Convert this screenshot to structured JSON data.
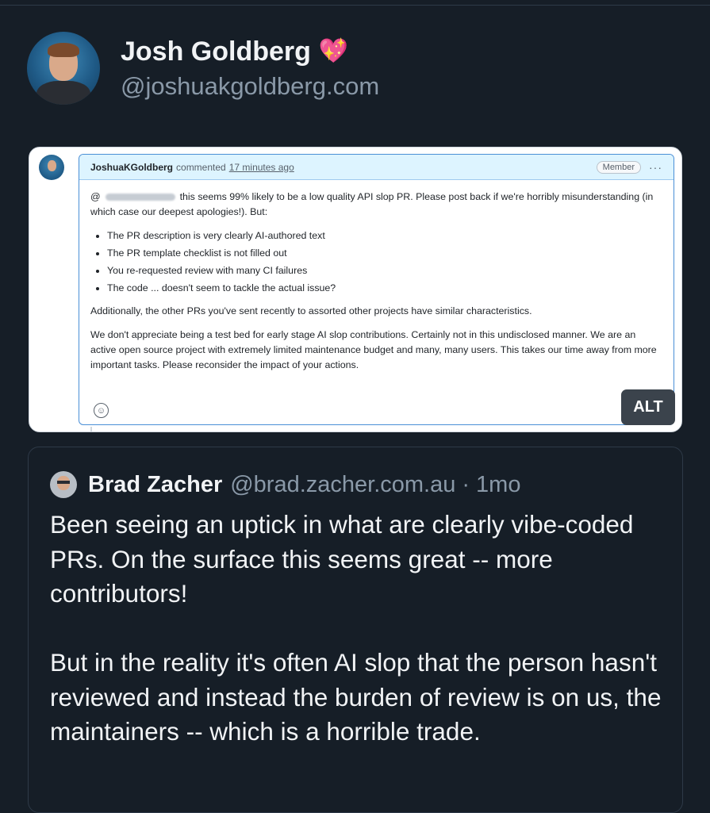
{
  "post": {
    "author_name": "Josh Goldberg",
    "author_emoji": "💖",
    "author_handle": "@joshuakgoldberg.com"
  },
  "embed": {
    "commenter": "JoshuaKGoldberg",
    "commented_label": "commented",
    "time": "17 minutes ago",
    "badge": "Member",
    "menu_glyph": "···",
    "mention_prefix": "@",
    "p1_rest": "this seems 99% likely to be a low quality API slop PR. Please post back if we're horribly misunderstanding (in which case our deepest apologies!). But:",
    "bullets": [
      "The PR description is very clearly AI-authored text",
      "The PR template checklist is not filled out",
      "You re-requested review with many CI failures",
      "The code ... doesn't seem to tackle the actual issue?"
    ],
    "p2": "Additionally, the other PRs you've sent recently to assorted other projects have similar characteristics.",
    "p3": "We don't appreciate being a test bed for early stage AI slop contributions. Certainly not in this undisclosed manner. We are an active open source project with extremely limited maintenance budget and many, many users. This takes our time away from more important tasks. Please reconsider the impact of your actions.",
    "alt_label": "ALT"
  },
  "quote": {
    "author_name": "Brad Zacher",
    "author_handle": "@brad.zacher.com.au",
    "separator": "·",
    "time": "1mo",
    "paragraphs": [
      "Been seeing an uptick in what are clearly vibe-coded PRs. On the surface this seems great -- more contributors!",
      "But in the reality it's often AI slop that the person hasn't reviewed and instead the burden of review is on us, the maintainers -- which is a horrible trade."
    ]
  },
  "colors": {
    "background": "#161e27",
    "muted_text": "#8a99a8",
    "comment_border": "#4a8fd6",
    "comment_header": "#ddf4ff"
  },
  "icons": [
    "heart-sparkle-icon",
    "kebab-menu-icon",
    "smiley-icon"
  ]
}
